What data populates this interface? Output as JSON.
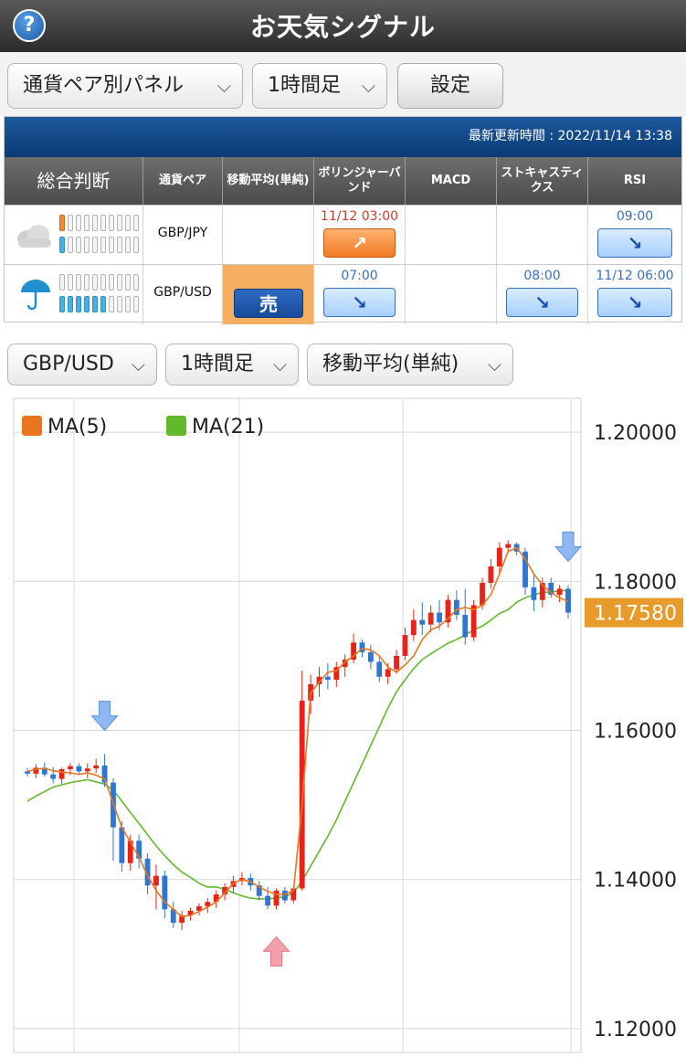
{
  "header": {
    "title": "お天気シグナル",
    "help_icon": "?"
  },
  "toolbar": {
    "panel_select": "通貨ペア別パネル",
    "timeframe_select": "1時間足",
    "settings_button": "設定"
  },
  "panel": {
    "update_label": "最新更新時間 : 2022/11/14 13:38",
    "headers": [
      "総合判断",
      "通貨ペア",
      "移動平均(単純)",
      "ボリンジャーバンド",
      "MACD",
      "ストキャスティクス",
      "RSI"
    ],
    "rows": [
      {
        "weather_icon": "cloud-icon",
        "pair": "GBP/JPY",
        "ma": "",
        "bollinger": {
          "time": "11/12 03:00",
          "signal": "up-arrow-icon"
        },
        "macd": "",
        "stochastics": "",
        "rsi": {
          "time": "09:00",
          "signal": "down-arrow-icon"
        }
      },
      {
        "weather_icon": "umbrella-icon",
        "pair": "GBP/USD",
        "ma": {
          "label": "売"
        },
        "bollinger": {
          "time": "07:00",
          "signal": "down-arrow-icon"
        },
        "macd": "",
        "stochastics": {
          "time": "08:00",
          "signal": "down-arrow-icon"
        },
        "rsi": {
          "time": "11/12 06:00",
          "signal": "down-arrow-icon"
        }
      }
    ]
  },
  "chart_controls": {
    "pair_select": "GBP/USD",
    "timeframe_select": "1時間足",
    "indicator_select": "移動平均(単純)"
  },
  "chart": {
    "legend": [
      {
        "name": "MA(5)",
        "color": "#e8761e"
      },
      {
        "name": "MA(21)",
        "color": "#63b82b"
      }
    ],
    "y_ticks": [
      "1.20000",
      "1.18000",
      "1.16000",
      "1.14000",
      "1.12000"
    ],
    "current_price": "1.17580",
    "colors": {
      "up_candle": "#e8241a",
      "down_candle": "#2d76d4",
      "ma5": "#e8761e",
      "ma21": "#63b82b",
      "price_badge": "#e89a2a"
    }
  },
  "chart_data": {
    "type": "line",
    "ylim": [
      1.12,
      1.2
    ],
    "series": [
      {
        "name": "MA(5)",
        "values": [
          1.1545,
          1.1548,
          1.1549,
          1.1546,
          1.1544,
          1.1543,
          1.1541,
          1.1543,
          1.154,
          1.1535,
          1.1502,
          1.147,
          1.145,
          1.143,
          1.1405,
          1.1385,
          1.137,
          1.136,
          1.135,
          1.1352,
          1.1357,
          1.1363,
          1.137,
          1.1382,
          1.1395,
          1.14,
          1.1397,
          1.139,
          1.1384,
          1.138,
          1.138,
          1.1385,
          1.15,
          1.165,
          1.1665,
          1.1678,
          1.168,
          1.1692,
          1.17,
          1.171,
          1.1708,
          1.17,
          1.1685,
          1.1678,
          1.1688,
          1.17,
          1.1722,
          1.1735,
          1.174,
          1.175,
          1.1762,
          1.1765,
          1.1762,
          1.1768,
          1.1782,
          1.181,
          1.184,
          1.1845,
          1.183,
          1.181,
          1.1795,
          1.1785,
          1.1778,
          1.1773
        ]
      },
      {
        "name": "MA(21)",
        "values": [
          1.1505,
          1.1512,
          1.1518,
          1.1524,
          1.1527,
          1.153,
          1.1532,
          1.1534,
          1.1531,
          1.1528,
          1.152,
          1.1505,
          1.149,
          1.1475,
          1.146,
          1.1445,
          1.1432,
          1.142,
          1.141,
          1.1403,
          1.1395,
          1.139,
          1.139,
          1.1387,
          1.1382,
          1.1378,
          1.1375,
          1.1374,
          1.1374,
          1.1375,
          1.1377,
          1.1382,
          1.1398,
          1.1418,
          1.1438,
          1.1458,
          1.148,
          1.1505,
          1.153,
          1.1555,
          1.158,
          1.1605,
          1.163,
          1.1652,
          1.1668,
          1.1683,
          1.1695,
          1.1703,
          1.171,
          1.1717,
          1.1722,
          1.1728,
          1.1735,
          1.174,
          1.1748,
          1.1757,
          1.1762,
          1.1772,
          1.1778,
          1.1782,
          1.1785,
          1.1786,
          1.1787,
          1.1788
        ]
      }
    ],
    "candles": [
      [
        1.1545,
        1.155,
        1.1538,
        1.1542
      ],
      [
        1.1542,
        1.1555,
        1.1536,
        1.155
      ],
      [
        1.155,
        1.1557,
        1.1538,
        1.1541
      ],
      [
        1.1541,
        1.1551,
        1.1529,
        1.1535
      ],
      [
        1.1535,
        1.155,
        1.1528,
        1.1548
      ],
      [
        1.1548,
        1.1556,
        1.154,
        1.1552
      ],
      [
        1.1552,
        1.1556,
        1.154,
        1.1545
      ],
      [
        1.1545,
        1.1556,
        1.1536,
        1.1549
      ],
      [
        1.1549,
        1.1562,
        1.1543,
        1.1553
      ],
      [
        1.1553,
        1.1568,
        1.1524,
        1.153
      ],
      [
        1.153,
        1.1536,
        1.1425,
        1.147
      ],
      [
        1.147,
        1.1478,
        1.141,
        1.1422
      ],
      [
        1.1422,
        1.146,
        1.1412,
        1.1452
      ],
      [
        1.1452,
        1.146,
        1.1415,
        1.1428
      ],
      [
        1.1428,
        1.1435,
        1.138,
        1.1392
      ],
      [
        1.1392,
        1.142,
        1.136,
        1.1405
      ],
      [
        1.1405,
        1.1412,
        1.1348,
        1.136
      ],
      [
        1.136,
        1.137,
        1.1335,
        1.1342
      ],
      [
        1.1342,
        1.1358,
        1.1332,
        1.1352
      ],
      [
        1.1352,
        1.1362,
        1.1345,
        1.1358
      ],
      [
        1.1358,
        1.1368,
        1.1352,
        1.1364
      ],
      [
        1.1364,
        1.1375,
        1.1355,
        1.137
      ],
      [
        1.137,
        1.1385,
        1.1362,
        1.138
      ],
      [
        1.138,
        1.1395,
        1.1372,
        1.139
      ],
      [
        1.139,
        1.1405,
        1.1382,
        1.1398
      ],
      [
        1.1398,
        1.141,
        1.1392,
        1.1402
      ],
      [
        1.1402,
        1.1408,
        1.1385,
        1.1392
      ],
      [
        1.1392,
        1.1398,
        1.1372,
        1.1378
      ],
      [
        1.1378,
        1.139,
        1.136,
        1.1365
      ],
      [
        1.1365,
        1.1388,
        1.136,
        1.1385
      ],
      [
        1.1385,
        1.139,
        1.1368,
        1.1372
      ],
      [
        1.1372,
        1.1392,
        1.1368,
        1.1388
      ],
      [
        1.1388,
        1.168,
        1.1385,
        1.164
      ],
      [
        1.164,
        1.1675,
        1.1622,
        1.1662
      ],
      [
        1.1662,
        1.1685,
        1.1645,
        1.1672
      ],
      [
        1.1672,
        1.169,
        1.1655,
        1.1668
      ],
      [
        1.1668,
        1.1692,
        1.1658,
        1.1685
      ],
      [
        1.1685,
        1.1702,
        1.1672,
        1.1695
      ],
      [
        1.1695,
        1.173,
        1.169,
        1.1718
      ],
      [
        1.1718,
        1.1722,
        1.1698,
        1.1705
      ],
      [
        1.1705,
        1.1715,
        1.1682,
        1.1692
      ],
      [
        1.1692,
        1.17,
        1.1665,
        1.1672
      ],
      [
        1.1672,
        1.169,
        1.1662,
        1.1682
      ],
      [
        1.1682,
        1.1708,
        1.1676,
        1.17
      ],
      [
        1.17,
        1.1738,
        1.1694,
        1.1728
      ],
      [
        1.1728,
        1.1762,
        1.172,
        1.1748
      ],
      [
        1.1748,
        1.1772,
        1.1728,
        1.1742
      ],
      [
        1.1742,
        1.1768,
        1.1732,
        1.1758
      ],
      [
        1.1758,
        1.1775,
        1.1735,
        1.1745
      ],
      [
        1.1745,
        1.1782,
        1.1738,
        1.1775
      ],
      [
        1.1775,
        1.1788,
        1.1748,
        1.1755
      ],
      [
        1.1755,
        1.179,
        1.1715,
        1.1725
      ],
      [
        1.1725,
        1.1775,
        1.172,
        1.1768
      ],
      [
        1.1768,
        1.1805,
        1.1762,
        1.1798
      ],
      [
        1.1798,
        1.183,
        1.179,
        1.182
      ],
      [
        1.182,
        1.1852,
        1.181,
        1.1845
      ],
      [
        1.1845,
        1.1855,
        1.1838,
        1.185
      ],
      [
        1.185,
        1.1852,
        1.1835,
        1.184
      ],
      [
        1.184,
        1.1845,
        1.1782,
        1.1792
      ],
      [
        1.1792,
        1.181,
        1.176,
        1.1775
      ],
      [
        1.1775,
        1.1805,
        1.1765,
        1.1798
      ],
      [
        1.1798,
        1.1805,
        1.1778,
        1.1782
      ],
      [
        1.1782,
        1.1795,
        1.1772,
        1.179
      ],
      [
        1.179,
        1.1795,
        1.175,
        1.1758
      ]
    ],
    "markers": [
      {
        "index": 9,
        "direction": "down"
      },
      {
        "index": 29,
        "direction": "up"
      },
      {
        "index": 63,
        "direction": "down"
      }
    ]
  }
}
